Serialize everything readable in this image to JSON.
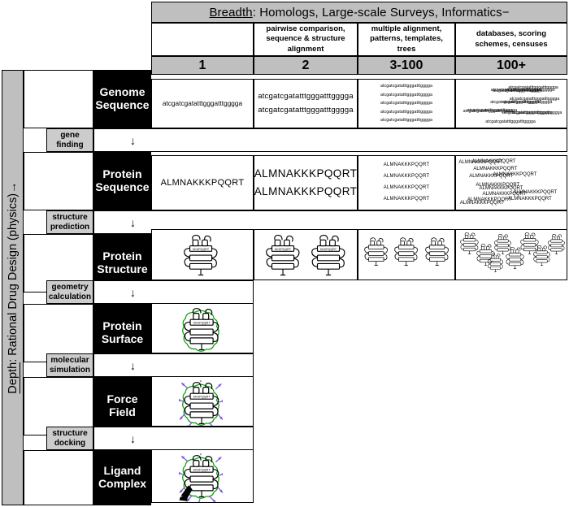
{
  "header": {
    "breadth_prefix": "Breadth",
    "breadth_title": ": Homologs, Large-scale Surveys, Informatics−",
    "columns": [
      {
        "desc": "",
        "count": "1"
      },
      {
        "desc": "pairwise comparison, sequence & structure alignment",
        "count": "2"
      },
      {
        "desc": "multiple alignment, patterns, templates, trees",
        "count": "3-100"
      },
      {
        "desc": "databases, scoring schemes, censuses",
        "count": "100+"
      }
    ]
  },
  "depth": {
    "prefix": "Depth",
    "label": ": Rational Drug Design (physics)→"
  },
  "rows": [
    {
      "name": "Genome Sequence",
      "kind": "dna"
    },
    {
      "name": "Protein Sequence",
      "kind": "protein"
    },
    {
      "name": "Protein Structure",
      "kind": "structure"
    },
    {
      "name": "Protein Surface",
      "kind": "surface"
    },
    {
      "name": "Force Field",
      "kind": "forcefield"
    },
    {
      "name": "Ligand Complex",
      "kind": "ligand"
    }
  ],
  "transitions": [
    {
      "label": "gene finding",
      "arrow": "↓"
    },
    {
      "label": "structure prediction",
      "arrow": "↓"
    },
    {
      "label": "geometry calculation",
      "arrow": "↓"
    },
    {
      "label": "molecular simulation",
      "arrow": "↓"
    },
    {
      "label": "structure docking",
      "arrow": "↓"
    }
  ],
  "sequences": {
    "dna": "atcgatcgatatttgggatttgggga",
    "protein": "ALMNAKKKPQQRT"
  },
  "cell_contents": {
    "genome": {
      "c1_lines": 1,
      "c2_lines": 2,
      "c3_lines": 5,
      "c4_lines": 12
    },
    "protein_sequence": {
      "c1_lines": 1,
      "c2_lines": 2,
      "c3_lines": 4,
      "c4_lines": 12
    },
    "protein_structure": {
      "c1_count": 1,
      "c2_count": 2,
      "c3_count": 3,
      "c4_count": 8
    }
  },
  "colors": {
    "header_grey": "#bfbfbf",
    "stage_grey": "#cccccc",
    "row_label_bg": "#000000",
    "row_label_fg": "#ffffff",
    "surface_green": "#00a000",
    "force_purple": "#7b5ad6"
  }
}
